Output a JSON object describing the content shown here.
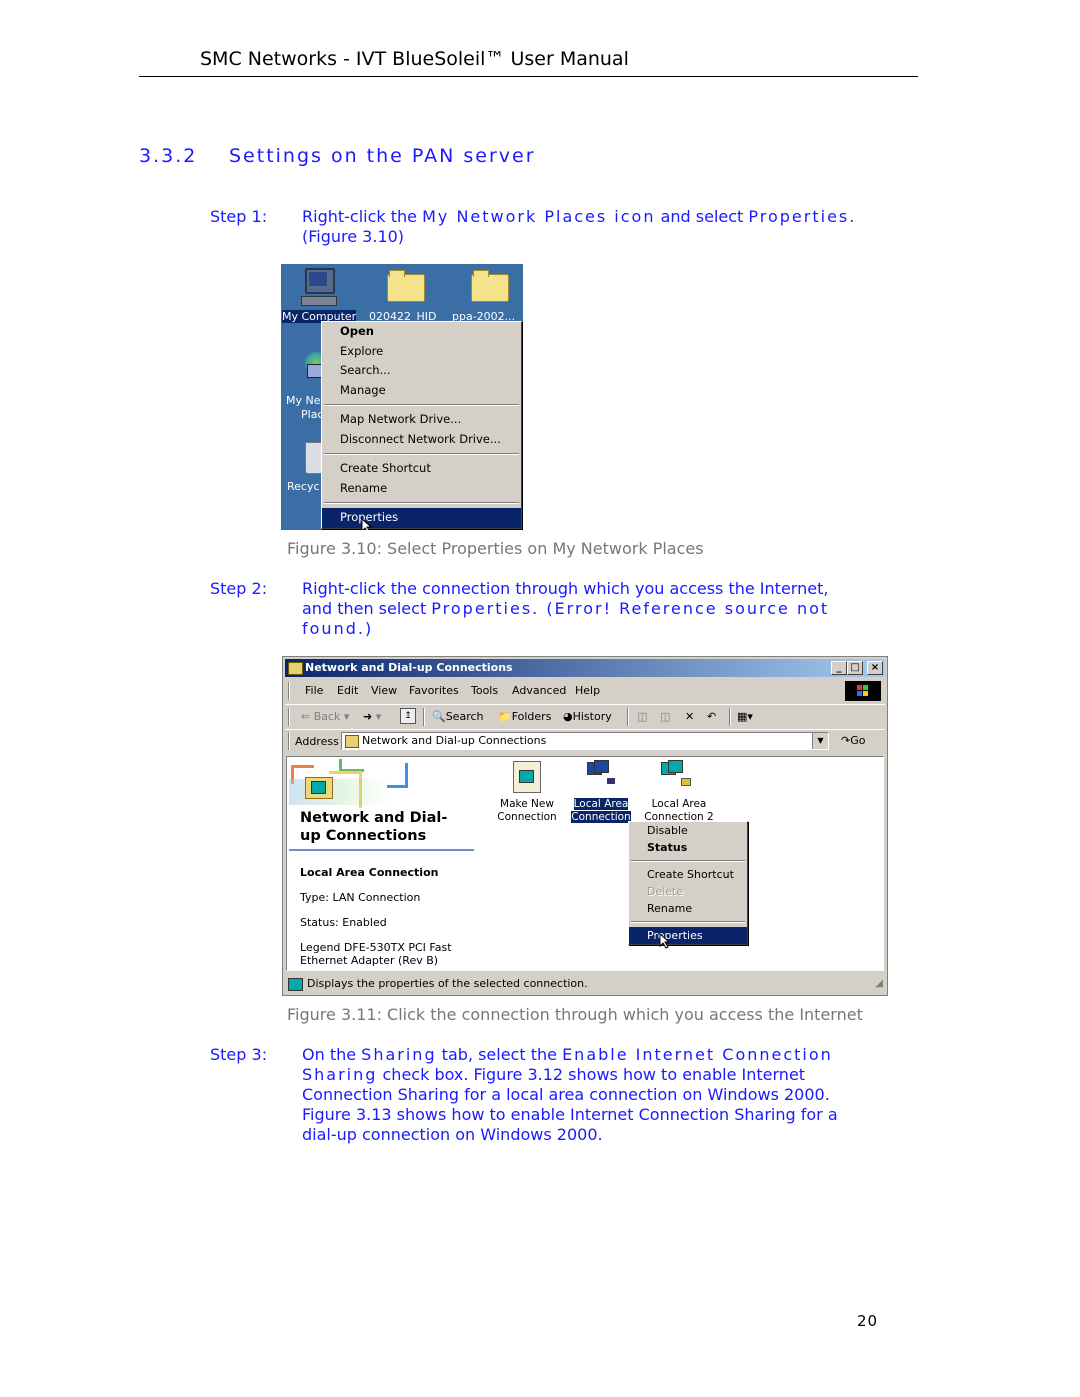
{
  "header": {
    "title": "SMC Networks - IVT BlueSoleil™ User Manual"
  },
  "section": {
    "number": "3.3.2",
    "title": "Settings on the PAN server"
  },
  "steps": [
    {
      "label": "Step 1:",
      "lines": [
        "Right-click the My Network Places icon and select Properties.",
        "(Figure 3.10)"
      ],
      "parts": {
        "pre": "Right-click the ",
        "term1": "My Network Places icon",
        "mid": " and select ",
        "term2": "Properties.",
        "line2": "(Figure 3.10)"
      }
    },
    {
      "label": "Step 2:",
      "parts": {
        "line1": "Right-click the connection through which you access the Internet,",
        "pre2": "and then select ",
        "term": "Properties",
        "post2": ". (Error! Reference source not",
        "line3": "found.)"
      }
    },
    {
      "label": "Step 3:",
      "parts": {
        "pre1": "On the ",
        "term1": "Sharing",
        "mid1": " tab, select the ",
        "term2": "Enable Internet Connection",
        "term3": "Sharing",
        "post2": " check box. Figure 3.12 shows how to enable Internet",
        "line3": "Connection Sharing for a local area connection on Windows 2000.",
        "line4": "Figure 3.13 shows how to enable Internet Connection Sharing for a",
        "line5": "dial-up connection on Windows 2000."
      }
    }
  ],
  "figure_3_10": {
    "caption": "Figure 3.10: Select Properties on My Network Places",
    "desktop_icons": [
      {
        "label": "My Computer",
        "icon": "computer-icon",
        "selected": true
      },
      {
        "label": "020422_HID",
        "icon": "folder-icon"
      },
      {
        "label": "ppa-2002...",
        "icon": "folder-icon"
      },
      {
        "label_line1": "My Ne",
        "label_line2": "Plac",
        "icon": "network-places-icon"
      },
      {
        "label": "Recyc",
        "icon": "recycle-bin-icon"
      }
    ],
    "context_menu": [
      {
        "label": "Open",
        "bold": true
      },
      {
        "label": "Explore"
      },
      {
        "label": "Search..."
      },
      {
        "label": "Manage"
      },
      {
        "separator": true
      },
      {
        "label": "Map Network Drive..."
      },
      {
        "label": "Disconnect Network Drive..."
      },
      {
        "separator": true
      },
      {
        "label": "Create Shortcut"
      },
      {
        "label": "Rename"
      },
      {
        "separator": true
      },
      {
        "label": "Properties",
        "selected": true
      }
    ]
  },
  "figure_3_11": {
    "caption": "Figure 3.11: Click the connection through which you access the Internet",
    "window_title": "Network and Dial-up Connections",
    "title_buttons": {
      "minimize": "_",
      "maximize": "□",
      "close": "×"
    },
    "menu": [
      "File",
      "Edit",
      "View",
      "Favorites",
      "Tools",
      "Advanced",
      "Help"
    ],
    "toolbar": {
      "back": "Back",
      "search": "Search",
      "folders": "Folders",
      "history": "History"
    },
    "address": {
      "label": "Address",
      "value": "Network and Dial-up Connections",
      "go": "Go"
    },
    "left_panel": {
      "heading_line1": "Network and Dial-",
      "heading_line2": "up Connections",
      "selected_name": "Local Area Connection",
      "type": "Type: LAN Connection",
      "status": "Status: Enabled",
      "adapter_line1": "Legend DFE-530TX PCI Fast",
      "adapter_line2": "Ethernet Adapter (Rev B)"
    },
    "icons": [
      {
        "line1": "Make New",
        "line2": "Connection"
      },
      {
        "line1": "Local Area",
        "line2": "Connection",
        "selected": true
      },
      {
        "line1": "Local Area",
        "line2": "Connection 2"
      }
    ],
    "context_menu": [
      {
        "label": "Disable"
      },
      {
        "label": "Status",
        "bold": true
      },
      {
        "separator": true
      },
      {
        "label": "Create Shortcut"
      },
      {
        "label": "Delete",
        "disabled": true
      },
      {
        "label": "Rename"
      },
      {
        "separator": true
      },
      {
        "label": "Properties",
        "selected": true
      }
    ],
    "status_bar": "Displays the properties of the selected connection."
  },
  "colors": {
    "body_text": "#1a1aff",
    "caption": "#777777",
    "desktop": "#3a6ea5",
    "selection": "#0a246a",
    "win_face": "#d4d0c8"
  },
  "page_number": "20"
}
